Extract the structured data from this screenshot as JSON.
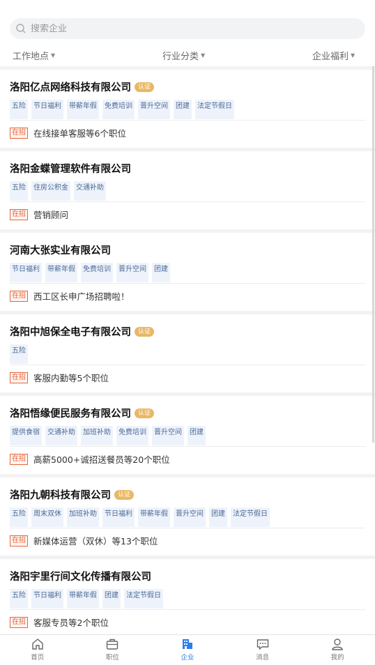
{
  "search": {
    "placeholder": "搜索企业"
  },
  "filters": [
    {
      "label": "工作地点"
    },
    {
      "label": "行业分类"
    },
    {
      "label": "企业福利"
    }
  ],
  "companies": [
    {
      "name": "洛阳亿点网络科技有限公司",
      "verified": true,
      "verified_label": "认证",
      "tags": [
        "五险",
        "节日福利",
        "带薪年假",
        "免费培训",
        "晋升空间",
        "团建",
        "法定节假日"
      ],
      "status": "在招",
      "jobs": "在线接单客服等6个职位"
    },
    {
      "name": "洛阳金蝶管理软件有限公司",
      "verified": false,
      "tags": [
        "五险",
        "住房公积金",
        "交通补助"
      ],
      "status": "在招",
      "jobs": "营销顾问"
    },
    {
      "name": "河南大张实业有限公司",
      "verified": false,
      "tags": [
        "节日福利",
        "带薪年假",
        "免费培训",
        "晋升空间",
        "团建"
      ],
      "status": "在招",
      "jobs": "西工区长申广场招聘啦！"
    },
    {
      "name": "洛阳中旭保全电子有限公司",
      "verified": true,
      "verified_label": "认证",
      "tags": [
        "五险"
      ],
      "status": "在招",
      "jobs": "客服内勤等5个职位"
    },
    {
      "name": "洛阳悟缘便民服务有限公司",
      "verified": true,
      "verified_label": "认证",
      "tags": [
        "提供食宿",
        "交通补助",
        "加班补助",
        "免费培训",
        "晋升空间",
        "团建"
      ],
      "status": "在招",
      "jobs": "高薪5000+诚招送餐员等20个职位"
    },
    {
      "name": "洛阳九朝科技有限公司",
      "verified": true,
      "verified_label": "认证",
      "tags": [
        "五险",
        "周末双休",
        "加班补助",
        "节日福利",
        "带薪年假",
        "晋升空间",
        "团建",
        "法定节假日"
      ],
      "status": "在招",
      "jobs": "新媒体运营（双休）等13个职位"
    },
    {
      "name": "洛阳宇里行间文化传播有限公司",
      "verified": false,
      "tags": [
        "五险",
        "节日福利",
        "带薪年假",
        "团建",
        "法定节假日"
      ],
      "status": "在招",
      "jobs": "客服专员等2个职位"
    }
  ],
  "tabbar": [
    {
      "label": "首页",
      "icon": "home-icon",
      "active": false
    },
    {
      "label": "职位",
      "icon": "briefcase-icon",
      "active": false
    },
    {
      "label": "企业",
      "icon": "building-icon",
      "active": true
    },
    {
      "label": "消息",
      "icon": "message-icon",
      "active": false
    },
    {
      "label": "我的",
      "icon": "user-icon",
      "active": false
    }
  ],
  "colors": {
    "accent": "#2a7ef0",
    "badge": "#e8b866",
    "hiring": "#e8643a",
    "tag_bg": "#eef3fb"
  }
}
